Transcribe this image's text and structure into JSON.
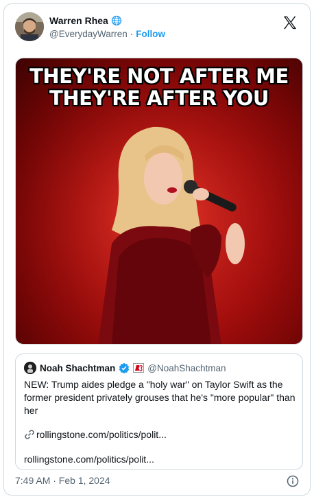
{
  "author": {
    "display_name": "Warren Rhea",
    "handle": "@EverydayWarren",
    "separator": "·",
    "follow_label": "Follow"
  },
  "media": {
    "meme_line1": "THEY'RE NOT AFTER ME",
    "meme_line2": "THEY'RE AFTER YOU"
  },
  "quoted": {
    "display_name": "Noah Shachtman",
    "handle": "@NoahShachtman",
    "text": "NEW: Trump aides pledge a \"holy war\" on Taylor Swift as the former president privately grouses that he's \"more popular\" than her",
    "link_inline": "rollingstone.com/politics/polit...",
    "link_card": "rollingstone.com/politics/polit..."
  },
  "timestamp": "7:49 AM · Feb 1, 2024",
  "colors": {
    "accent": "#1d9bf0",
    "meme_red": "#c91414",
    "border": "#cfd9de"
  }
}
